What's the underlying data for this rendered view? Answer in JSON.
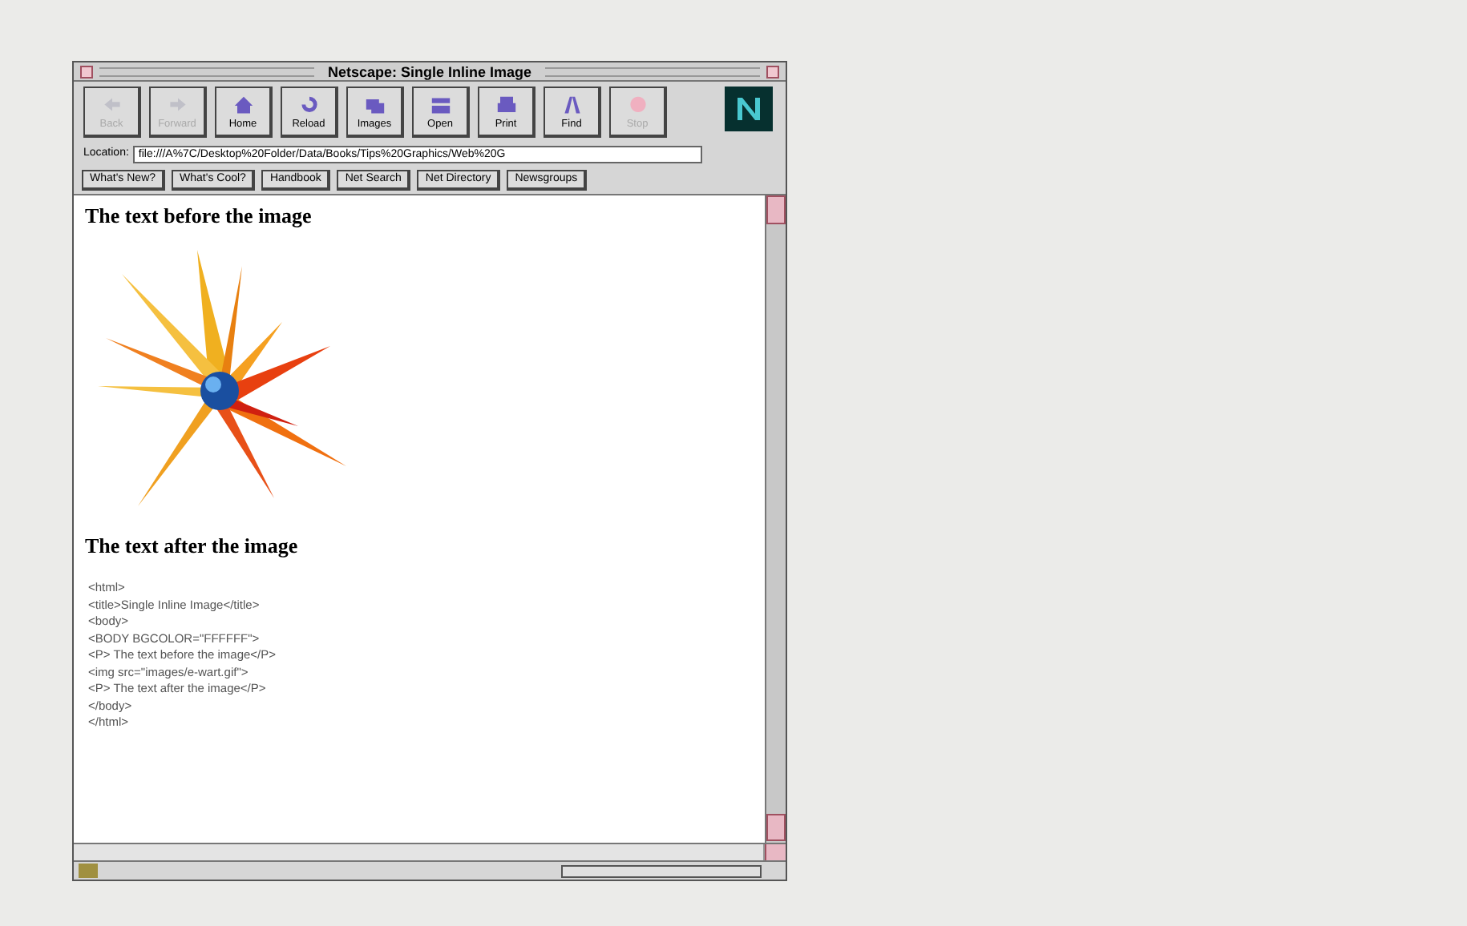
{
  "window": {
    "title": "Netscape: Single Inline Image"
  },
  "toolbar": [
    {
      "label": "Back",
      "disabled": true
    },
    {
      "label": "Forward",
      "disabled": true
    },
    {
      "label": "Home",
      "disabled": false
    },
    {
      "label": "Reload",
      "disabled": false
    },
    {
      "label": "Images",
      "disabled": false
    },
    {
      "label": "Open",
      "disabled": false
    },
    {
      "label": "Print",
      "disabled": false
    },
    {
      "label": "Find",
      "disabled": false
    },
    {
      "label": "Stop",
      "disabled": true
    }
  ],
  "location": {
    "label": "Location:",
    "value": "file:///A%7C/Desktop%20Folder/Data/Books/Tips%20Graphics/Web%20G"
  },
  "directory_buttons": [
    "What's New?",
    "What's Cool?",
    "Handbook",
    "Net Search",
    "Net Directory",
    "Newsgroups"
  ],
  "content": {
    "heading_before": "The text before the image",
    "heading_after": "The text after the image",
    "code_lines": [
      "<html>",
      "<title>Single Inline Image</title>",
      "<body>",
      "<BODY BGCOLOR=\"FFFFFF\">",
      "<P> The text before the image</P>",
      "<img src=\"images/e-wart.gif\">",
      "<P> The text after the image</P>",
      "</body>",
      "</html>"
    ]
  }
}
